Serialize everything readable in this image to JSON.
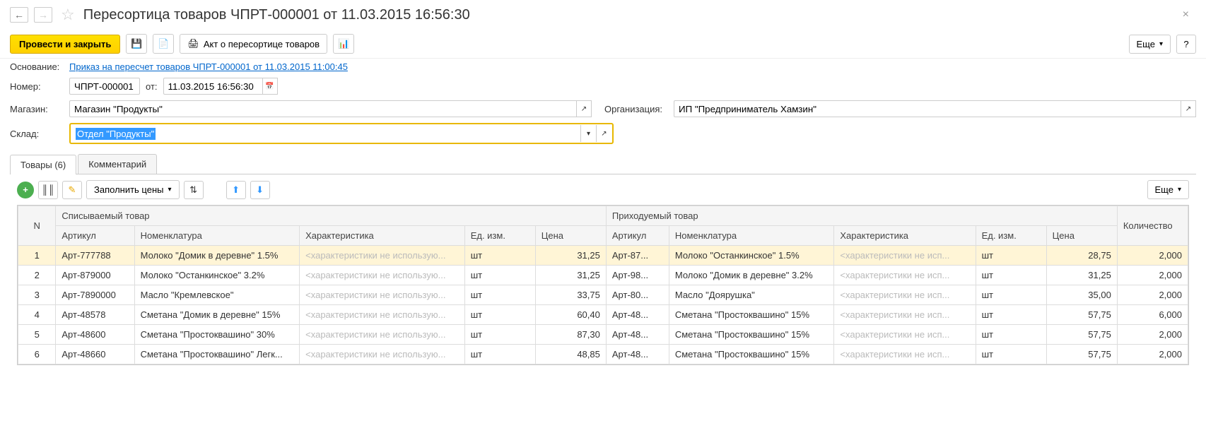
{
  "header": {
    "title": "Пересортица товаров ЧПРТ-000001 от 11.03.2015 16:56:30"
  },
  "toolbar": {
    "submit_close": "Провести и закрыть",
    "act_report": "Акт о пересортице товаров",
    "more": "Еще",
    "help": "?"
  },
  "form": {
    "basis_label": "Основание:",
    "basis_link": "Приказ на пересчет товаров ЧПРТ-000001 от 11.03.2015 11:00:45",
    "number_label": "Номер:",
    "number_value": "ЧПРТ-000001",
    "from_label": "от:",
    "date_value": "11.03.2015 16:56:30",
    "store_label": "Магазин:",
    "store_value": "Магазин \"Продукты\"",
    "org_label": "Организация:",
    "org_value": "ИП \"Предприниматель Хамзин\"",
    "warehouse_label": "Склад:",
    "warehouse_value": "Отдел \"Продукты\""
  },
  "tabs": {
    "goods": "Товары (6)",
    "comment": "Комментарий"
  },
  "table_toolbar": {
    "fill_prices": "Заполнить цены",
    "more": "Еще"
  },
  "grid": {
    "headers": {
      "n": "N",
      "writeoff_group": "Списываемый товар",
      "income_group": "Приходуемый товар",
      "article": "Артикул",
      "nomenclature": "Номенклатура",
      "characteristic": "Характеристика",
      "unit": "Ед. изм.",
      "price": "Цена",
      "quantity": "Количество"
    },
    "char_placeholder_long": "<характеристики не использую...",
    "char_placeholder_short": "<характеристики не исп...",
    "rows": [
      {
        "n": "1",
        "art": "Арт-777788",
        "name": "Молоко \"Домик в деревне\" 1.5%",
        "unit": "шт",
        "price": "31,25",
        "art2": "Арт-87...",
        "name2": "Молоко \"Останкинское\" 1.5%",
        "unit2": "шт",
        "price2": "28,75",
        "qty": "2,000"
      },
      {
        "n": "2",
        "art": "Арт-879000",
        "name": "Молоко \"Останкинское\" 3.2%",
        "unit": "шт",
        "price": "31,25",
        "art2": "Арт-98...",
        "name2": "Молоко \"Домик в деревне\" 3.2%",
        "unit2": "шт",
        "price2": "31,25",
        "qty": "2,000"
      },
      {
        "n": "3",
        "art": "Арт-7890000",
        "name": "Масло \"Кремлевское\"",
        "unit": "шт",
        "price": "33,75",
        "art2": "Арт-80...",
        "name2": "Масло \"Доярушка\"",
        "unit2": "шт",
        "price2": "35,00",
        "qty": "2,000"
      },
      {
        "n": "4",
        "art": "Арт-48578",
        "name": "Сметана \"Домик в деревне\" 15%",
        "unit": "шт",
        "price": "60,40",
        "art2": "Арт-48...",
        "name2": "Сметана \"Простоквашино\" 15%",
        "unit2": "шт",
        "price2": "57,75",
        "qty": "6,000"
      },
      {
        "n": "5",
        "art": "Арт-48600",
        "name": "Сметана \"Простоквашино\" 30%",
        "unit": "шт",
        "price": "87,30",
        "art2": "Арт-48...",
        "name2": "Сметана \"Простоквашино\" 15%",
        "unit2": "шт",
        "price2": "57,75",
        "qty": "2,000"
      },
      {
        "n": "6",
        "art": "Арт-48660",
        "name": "Сметана \"Простоквашино\" Легк...",
        "unit": "шт",
        "price": "48,85",
        "art2": "Арт-48...",
        "name2": "Сметана \"Простоквашино\" 15%",
        "unit2": "шт",
        "price2": "57,75",
        "qty": "2,000"
      }
    ]
  }
}
